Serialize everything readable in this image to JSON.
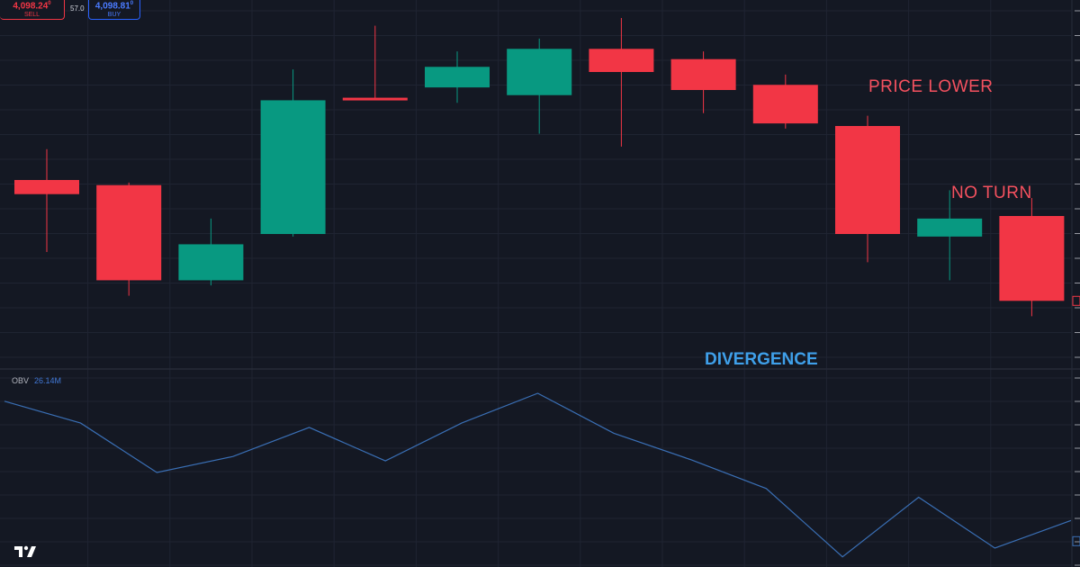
{
  "trade": {
    "sell_price_main": "4,098.24",
    "sell_price_sup": "0",
    "sell_label": "SELL",
    "spread": "57.0",
    "buy_price_main": "4,098.81",
    "buy_price_sup": "0",
    "buy_label": "BUY"
  },
  "indicator": {
    "name": "OBV",
    "value": "26.14M"
  },
  "annotations": {
    "price_lower": "PRICE LOWER",
    "no_turn": "NO TURN",
    "divergence": "DIVERGENCE"
  },
  "colors": {
    "background": "#141823",
    "up": "#089981",
    "down": "#f23645",
    "obv_line": "#3a6fb5",
    "grid": "#1f2432",
    "price_lower_text": "#f5515f",
    "no_turn_text": "#f5515f",
    "divergence_text": "#3fa0ea"
  },
  "chart_data": [
    {
      "type": "candlestick",
      "title": "",
      "candles": [
        {
          "open": 70,
          "close": 64.5,
          "high": 82,
          "low": 42
        },
        {
          "open": 68,
          "close": 31,
          "high": 69,
          "low": 25
        },
        {
          "open": 31,
          "close": 45,
          "high": 55,
          "low": 29
        },
        {
          "open": 49,
          "close": 101,
          "high": 113,
          "low": 48
        },
        {
          "open": 102,
          "close": 101,
          "high": 130,
          "low": 101
        },
        {
          "open": 106,
          "close": 114,
          "high": 120,
          "low": 100
        },
        {
          "open": 103,
          "close": 121,
          "high": 125,
          "low": 88
        },
        {
          "open": 121,
          "close": 112,
          "high": 133,
          "low": 83
        },
        {
          "open": 117,
          "close": 105,
          "high": 120,
          "low": 96
        },
        {
          "open": 107,
          "close": 92,
          "high": 111,
          "low": 90
        },
        {
          "open": 91,
          "close": 49,
          "high": 95,
          "low": 38
        },
        {
          "open": 48,
          "close": 55,
          "high": 66,
          "low": 31
        },
        {
          "open": 56,
          "close": 23,
          "high": 63,
          "low": 17
        }
      ],
      "ylim": [
        0,
        140
      ]
    },
    {
      "type": "line",
      "title": "OBV",
      "series": [
        {
          "name": "OBV",
          "values": [
            28.4,
            26.9,
            23.5,
            24.6,
            26.6,
            24.3,
            26.9,
            28.95,
            26.2,
            24.4,
            22.4,
            17.7,
            21.8,
            18.3,
            20.2
          ]
        }
      ],
      "ylim": [
        17,
        30
      ]
    }
  ]
}
